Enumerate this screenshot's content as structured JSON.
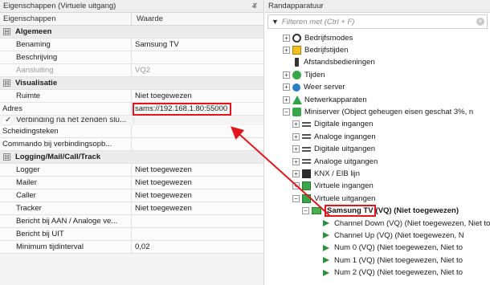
{
  "props": {
    "title": "Eigenschappen (Virtuele uitgang)",
    "pin_glyph": "ⶠ",
    "col_name": "Eigenschappen",
    "col_value": "Waarde",
    "rows": [
      {
        "type": "grp",
        "toggle": "⊟",
        "name": "Algemeen"
      },
      {
        "type": "sub",
        "name": "Benaming",
        "value": "Samsung TV"
      },
      {
        "type": "sub",
        "name": "Beschrijving",
        "value": ""
      },
      {
        "type": "sub",
        "name": "Aansluiting",
        "value": "VQ2",
        "disabled": true
      },
      {
        "type": "grp",
        "toggle": "⊟",
        "name": "Visualisatie"
      },
      {
        "type": "sub",
        "name": "Ruimte",
        "value": "Niet toegewezen"
      },
      {
        "type": "top",
        "name": "Adres",
        "value": "sams://192.168.1.80:55000"
      },
      {
        "type": "chk",
        "check": "✓",
        "name": "Verbinding na het zenden slu...",
        "value": ""
      },
      {
        "type": "top",
        "name": "Scheidingsteken",
        "value": ""
      },
      {
        "type": "top",
        "name": "Commando bij verbindingsopb...",
        "value": ""
      },
      {
        "type": "grp",
        "toggle": "⊟",
        "name": "Logging/Mail/Call/Track"
      },
      {
        "type": "sub",
        "name": "Logger",
        "value": "Niet toegewezen"
      },
      {
        "type": "sub",
        "name": "Mailer",
        "value": "Niet toegewezen"
      },
      {
        "type": "sub",
        "name": "Caller",
        "value": "Niet toegewezen"
      },
      {
        "type": "sub",
        "name": "Tracker",
        "value": "Niet toegewezen"
      },
      {
        "type": "sub",
        "name": "Bericht bij AAN / Analoge ve...",
        "value": ""
      },
      {
        "type": "sub",
        "name": "Bericht bij UIT",
        "value": ""
      },
      {
        "type": "sub",
        "name": "Minimum tijdinterval",
        "value": "0,02"
      }
    ]
  },
  "tree": {
    "title": "Randapparatuur",
    "filter_placeholder": "Filteren met (Ctrl + F)",
    "filter_icon": "▼",
    "clear_glyph": "×",
    "nodes": [
      {
        "level": 0,
        "exp": "+",
        "icon": "gear-icon",
        "cls": "ico-gear",
        "label": "Bedrijfsmodes"
      },
      {
        "level": 0,
        "exp": "+",
        "icon": "calendar-icon",
        "cls": "ico-cal",
        "label": "Bedrijfstijden"
      },
      {
        "level": 0,
        "exp": "",
        "icon": "remote-icon",
        "cls": "ico-remote",
        "label": "Afstandsbedieningen"
      },
      {
        "level": 0,
        "exp": "+",
        "icon": "clock-icon",
        "cls": "ico-clock",
        "label": "Tijden"
      },
      {
        "level": 0,
        "exp": "+",
        "icon": "weather-icon",
        "cls": "ico-weather",
        "label": "Weer server"
      },
      {
        "level": 0,
        "exp": "+",
        "icon": "network-icon",
        "cls": "ico-net",
        "label": "Netwerkapparaten"
      },
      {
        "level": 0,
        "exp": "−",
        "icon": "miniserver-icon",
        "cls": "ico-mini",
        "label": "Miniserver (Object geheugen eisen geschat 3%, n"
      },
      {
        "level": 1,
        "exp": "+",
        "icon": "digital-input-icon",
        "cls": "ico-io",
        "label": "Digitale ingangen"
      },
      {
        "level": 1,
        "exp": "+",
        "icon": "analog-input-icon",
        "cls": "ico-io",
        "label": "Analoge ingangen"
      },
      {
        "level": 1,
        "exp": "+",
        "icon": "digital-output-icon",
        "cls": "ico-io",
        "label": "Digitale uitgangen"
      },
      {
        "level": 1,
        "exp": "+",
        "icon": "analog-output-icon",
        "cls": "ico-io",
        "label": "Analoge uitgangen"
      },
      {
        "level": 1,
        "exp": "+",
        "icon": "knx-icon",
        "cls": "ico-knx",
        "label": "KNX / EIB lijn"
      },
      {
        "level": 1,
        "exp": "+",
        "icon": "virtual-input-icon",
        "cls": "ico-vin",
        "label": "Virtuele ingangen"
      },
      {
        "level": 1,
        "exp": "−",
        "icon": "virtual-output-icon",
        "cls": "ico-vout",
        "label": "Virtuele uitgangen"
      },
      {
        "level": 2,
        "exp": "−",
        "icon": "tv-icon",
        "cls": "ico-tv",
        "label": "Samsung TV",
        "suffix": " (VQ) (Niet toegewezen)",
        "bold": true
      },
      {
        "level": 3,
        "exp": "",
        "icon": "command-icon",
        "cls": "ico-cmd",
        "label": "Channel Down (VQ) (Niet toegewezen, Niet to"
      },
      {
        "level": 3,
        "exp": "",
        "icon": "command-icon",
        "cls": "ico-cmd",
        "label": "Channel Up (VQ) (Niet toegewezen, N"
      },
      {
        "level": 3,
        "exp": "",
        "icon": "command-icon",
        "cls": "ico-cmd",
        "label": "Num 0 (VQ) (Niet toegewezen, Niet to"
      },
      {
        "level": 3,
        "exp": "",
        "icon": "command-icon",
        "cls": "ico-cmd",
        "label": "Num 1 (VQ) (Niet toegewezen, Niet to"
      },
      {
        "level": 3,
        "exp": "",
        "icon": "command-icon",
        "cls": "ico-cmd",
        "label": "Num 2 (VQ) (Niet toegewezen, Niet to"
      }
    ]
  },
  "annotation": {
    "color": "#e0161b"
  }
}
